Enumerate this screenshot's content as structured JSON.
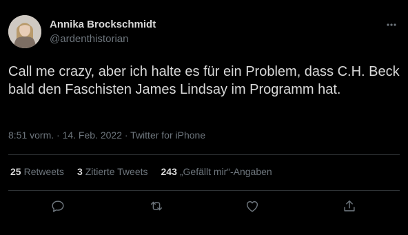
{
  "author": {
    "name": "Annika Brockschmidt",
    "handle": "@ardenthistorian"
  },
  "tweet": {
    "text": "Call me crazy, aber ich halte es für ein Problem, dass C.H. Beck bald den Faschisten James Lindsay im Programm hat.",
    "meta": "8:51 vorm. · 14. Feb. 2022 · Twitter for iPhone"
  },
  "stats": {
    "retweets_count": "25",
    "retweets_label": "Retweets",
    "quotes_count": "3",
    "quotes_label": "Zitierte Tweets",
    "likes_count": "243",
    "likes_label": "„Gefällt mir“-Angaben"
  },
  "icons": {
    "more": "more-icon",
    "reply": "reply-icon",
    "retweet": "retweet-icon",
    "like": "heart-icon",
    "share": "share-icon"
  },
  "colors": {
    "background": "#000000",
    "primary_text": "#d9d9d9",
    "secondary_text": "#6e767d",
    "divider": "#2f3336"
  }
}
